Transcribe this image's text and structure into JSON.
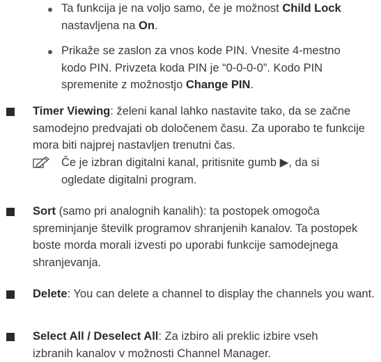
{
  "bullets": [
    {
      "pre": "Ta funkcija je na voljo samo, če je možnost ",
      "k1": "Child Lock",
      "mid": " nastavljena na ",
      "k2": "On",
      "post": "."
    },
    {
      "pre": "Prikaže se zaslon za vnos kode PIN. Vnesite 4-mestno kodo PIN. Privzeta koda PIN je “0-0-0-0”. Kodo PIN spremenite z možnostjo ",
      "k1": "Change PIN",
      "post": "."
    }
  ],
  "items": [
    {
      "term": "Timer Viewing",
      "text": ": želeni kanal lahko nastavite tako, da se začne samodejno predvajati ob določenem času. Za uporabo te funkcije mora biti najprej nastavljen trenutni čas."
    },
    {
      "term": "Sort",
      "text": " (samo pri analognih kanalih): ta postopek omogoča spreminjanje številk programov shranjenih kanalov. Ta postopek boste morda morali izvesti po uporabi funkcije samodejnega shranjevanja."
    },
    {
      "term": "Delete",
      "text": ": You can delete a channel to display the channels you want."
    },
    {
      "term": "Select All / Deselect All",
      "text": ": Za izbiro ali preklic izbire vseh izbranih kanalov v možnosti Channel Manager."
    }
  ],
  "note": {
    "icon": "note-pencil-icon",
    "text": "Če je izbran digitalni kanal, pritisnite gumb ▶, da si ogledate digitalni program."
  }
}
